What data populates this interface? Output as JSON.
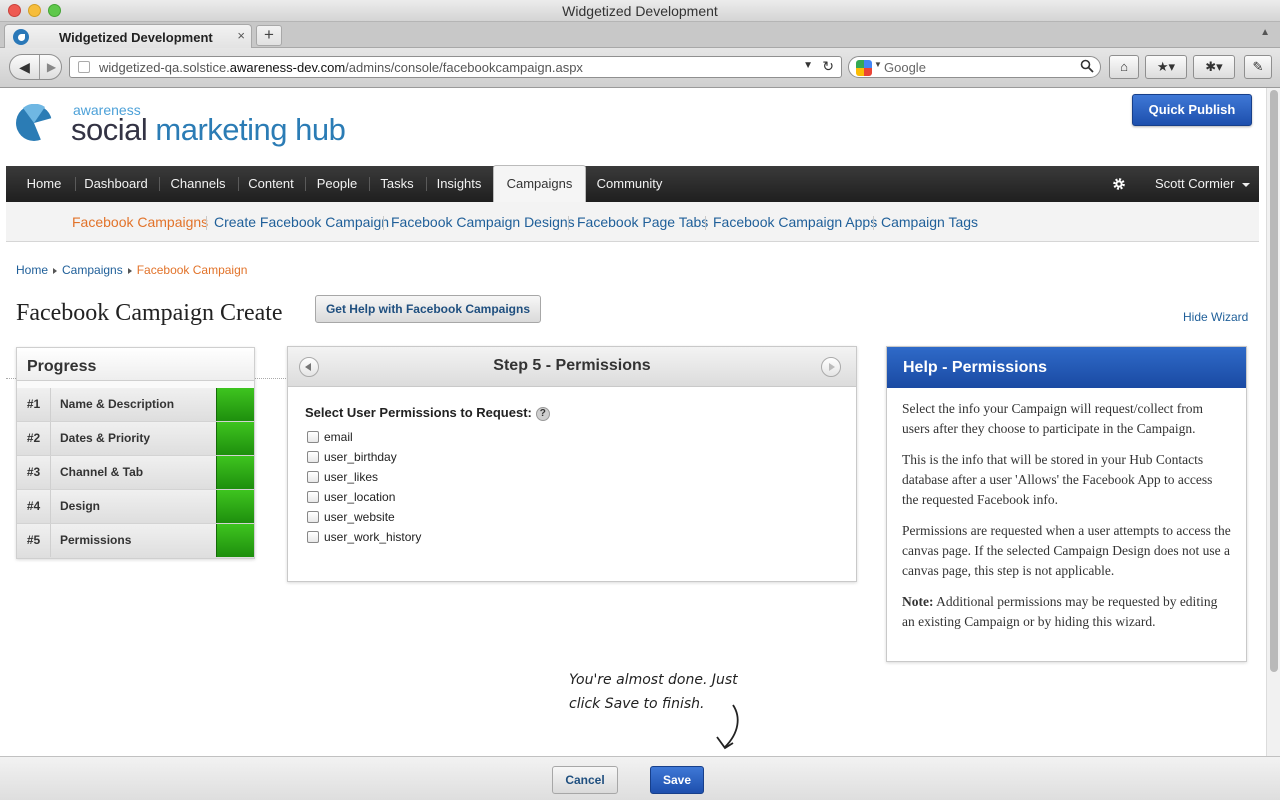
{
  "window": {
    "title": "Widgetized Development"
  },
  "browser": {
    "tab_title": "Widgetized Development",
    "tab_close": "×",
    "new_tab": "+",
    "url_prefix": "widgetized-qa.solstice.",
    "url_domain": "awareness-dev.com",
    "url_path": "/admins/console/facebookcampaign.aspx",
    "search_placeholder": "Google"
  },
  "header": {
    "logo_small": "awareness",
    "logo_big_a": "social",
    "logo_big_b": " marketing hub",
    "quick_publish": "Quick Publish",
    "user_name": "Scott Cormier"
  },
  "main_nav": [
    "Home",
    "Dashboard",
    "Channels",
    "Content",
    "People",
    "Tasks",
    "Insights",
    "Campaigns",
    "Community"
  ],
  "sub_nav": [
    "Facebook Campaigns",
    "Create Facebook Campaign",
    "Facebook Campaign Designs",
    "Facebook Page Tabs",
    "Facebook Campaign Apps",
    "Campaign Tags"
  ],
  "breadcrumb": [
    "Home",
    "Campaigns",
    "Facebook Campaign"
  ],
  "page": {
    "title": "Facebook Campaign Create",
    "help_button": "Get Help with Facebook Campaigns",
    "hide_wizard": "Hide Wizard"
  },
  "progress": {
    "title": "Progress",
    "steps": [
      {
        "num": "#1",
        "label": "Name & Description"
      },
      {
        "num": "#2",
        "label": "Dates & Priority"
      },
      {
        "num": "#3",
        "label": "Channel & Tab"
      },
      {
        "num": "#4",
        "label": "Design"
      },
      {
        "num": "#5",
        "label": "Permissions"
      }
    ]
  },
  "step": {
    "title": "Step 5 - Permissions",
    "prompt": "Select User Permissions to Request:",
    "help_icon": "?",
    "permissions": [
      "email",
      "user_birthday",
      "user_likes",
      "user_location",
      "user_website",
      "user_work_history"
    ]
  },
  "help": {
    "title": "Help - Permissions",
    "p1": "Select the info your Campaign will request/collect from users after they choose to participate in the Campaign.",
    "p2": "This is the info that will be stored in your Hub Contacts database after a user 'Allows' the Facebook App to access the requested Facebook info.",
    "p3": "Permissions are requested when a user attempts to access the canvas page. If the selected Campaign Design does not use a canvas page, this step is not applicable.",
    "note_label": "Note:",
    "note_text": " Additional permissions may be requested by editing an existing Campaign or by hiding this wizard."
  },
  "hint": {
    "line1": "You're almost done. Just",
    "line2": "click Save to finish."
  },
  "footer": {
    "cancel": "Cancel",
    "save": "Save"
  }
}
